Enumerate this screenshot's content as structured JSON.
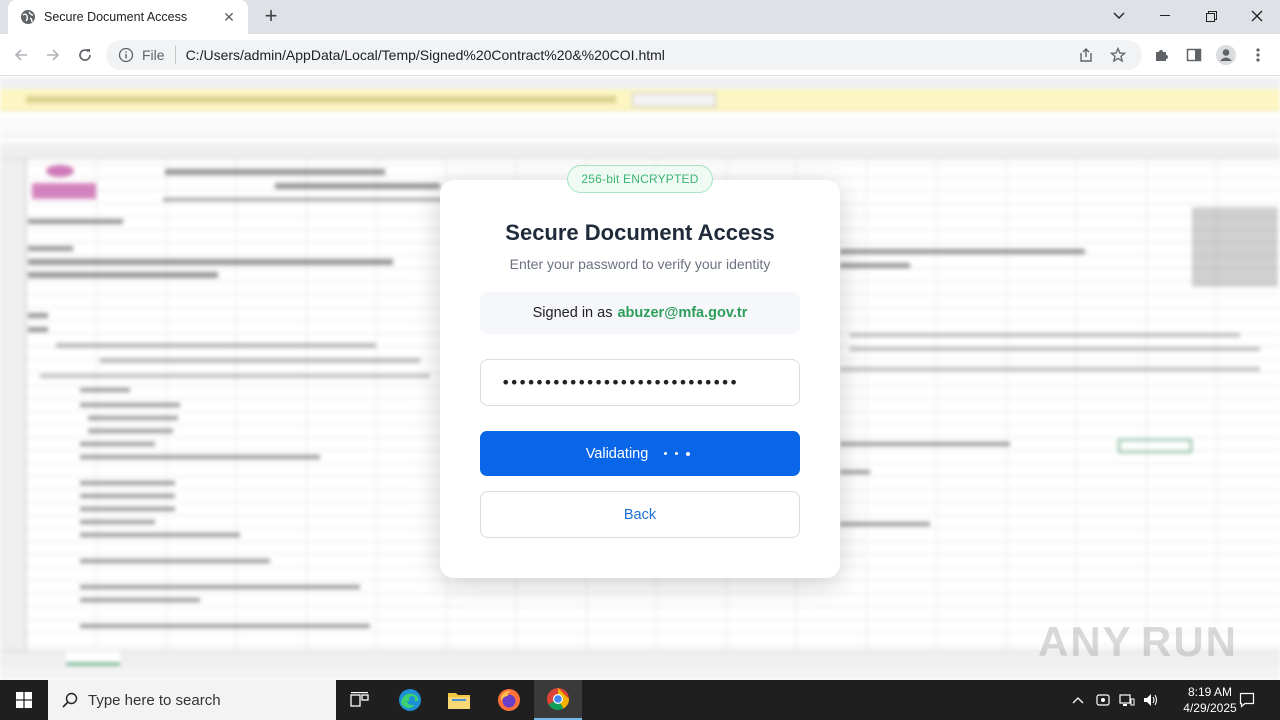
{
  "browser": {
    "tab_title": "Secure Document Access",
    "url_scheme": "File",
    "url": "C:/Users/admin/AppData/Local/Temp/Signed%20Contract%20&%20COI.html"
  },
  "modal": {
    "badge": "256-bit ENCRYPTED",
    "title": "Secure Document Access",
    "subtitle": "Enter your password to verify your identity",
    "signed_in_prefix": "Signed in as",
    "signed_in_email": "abuzer@mfa.gov.tr",
    "password_value": "••••••••••••••••••••••••••••",
    "validate_label": "Validating",
    "back_label": "Back"
  },
  "watermark": {
    "left": "ANY",
    "right": "RUN"
  },
  "taskbar": {
    "search_placeholder": "Type here to search",
    "time": "8:19 AM",
    "date": "4/29/2025"
  },
  "colors": {
    "primary_button": "#0a66e8",
    "email_green": "#2e9e5b",
    "badge_green": "#3cb371"
  }
}
